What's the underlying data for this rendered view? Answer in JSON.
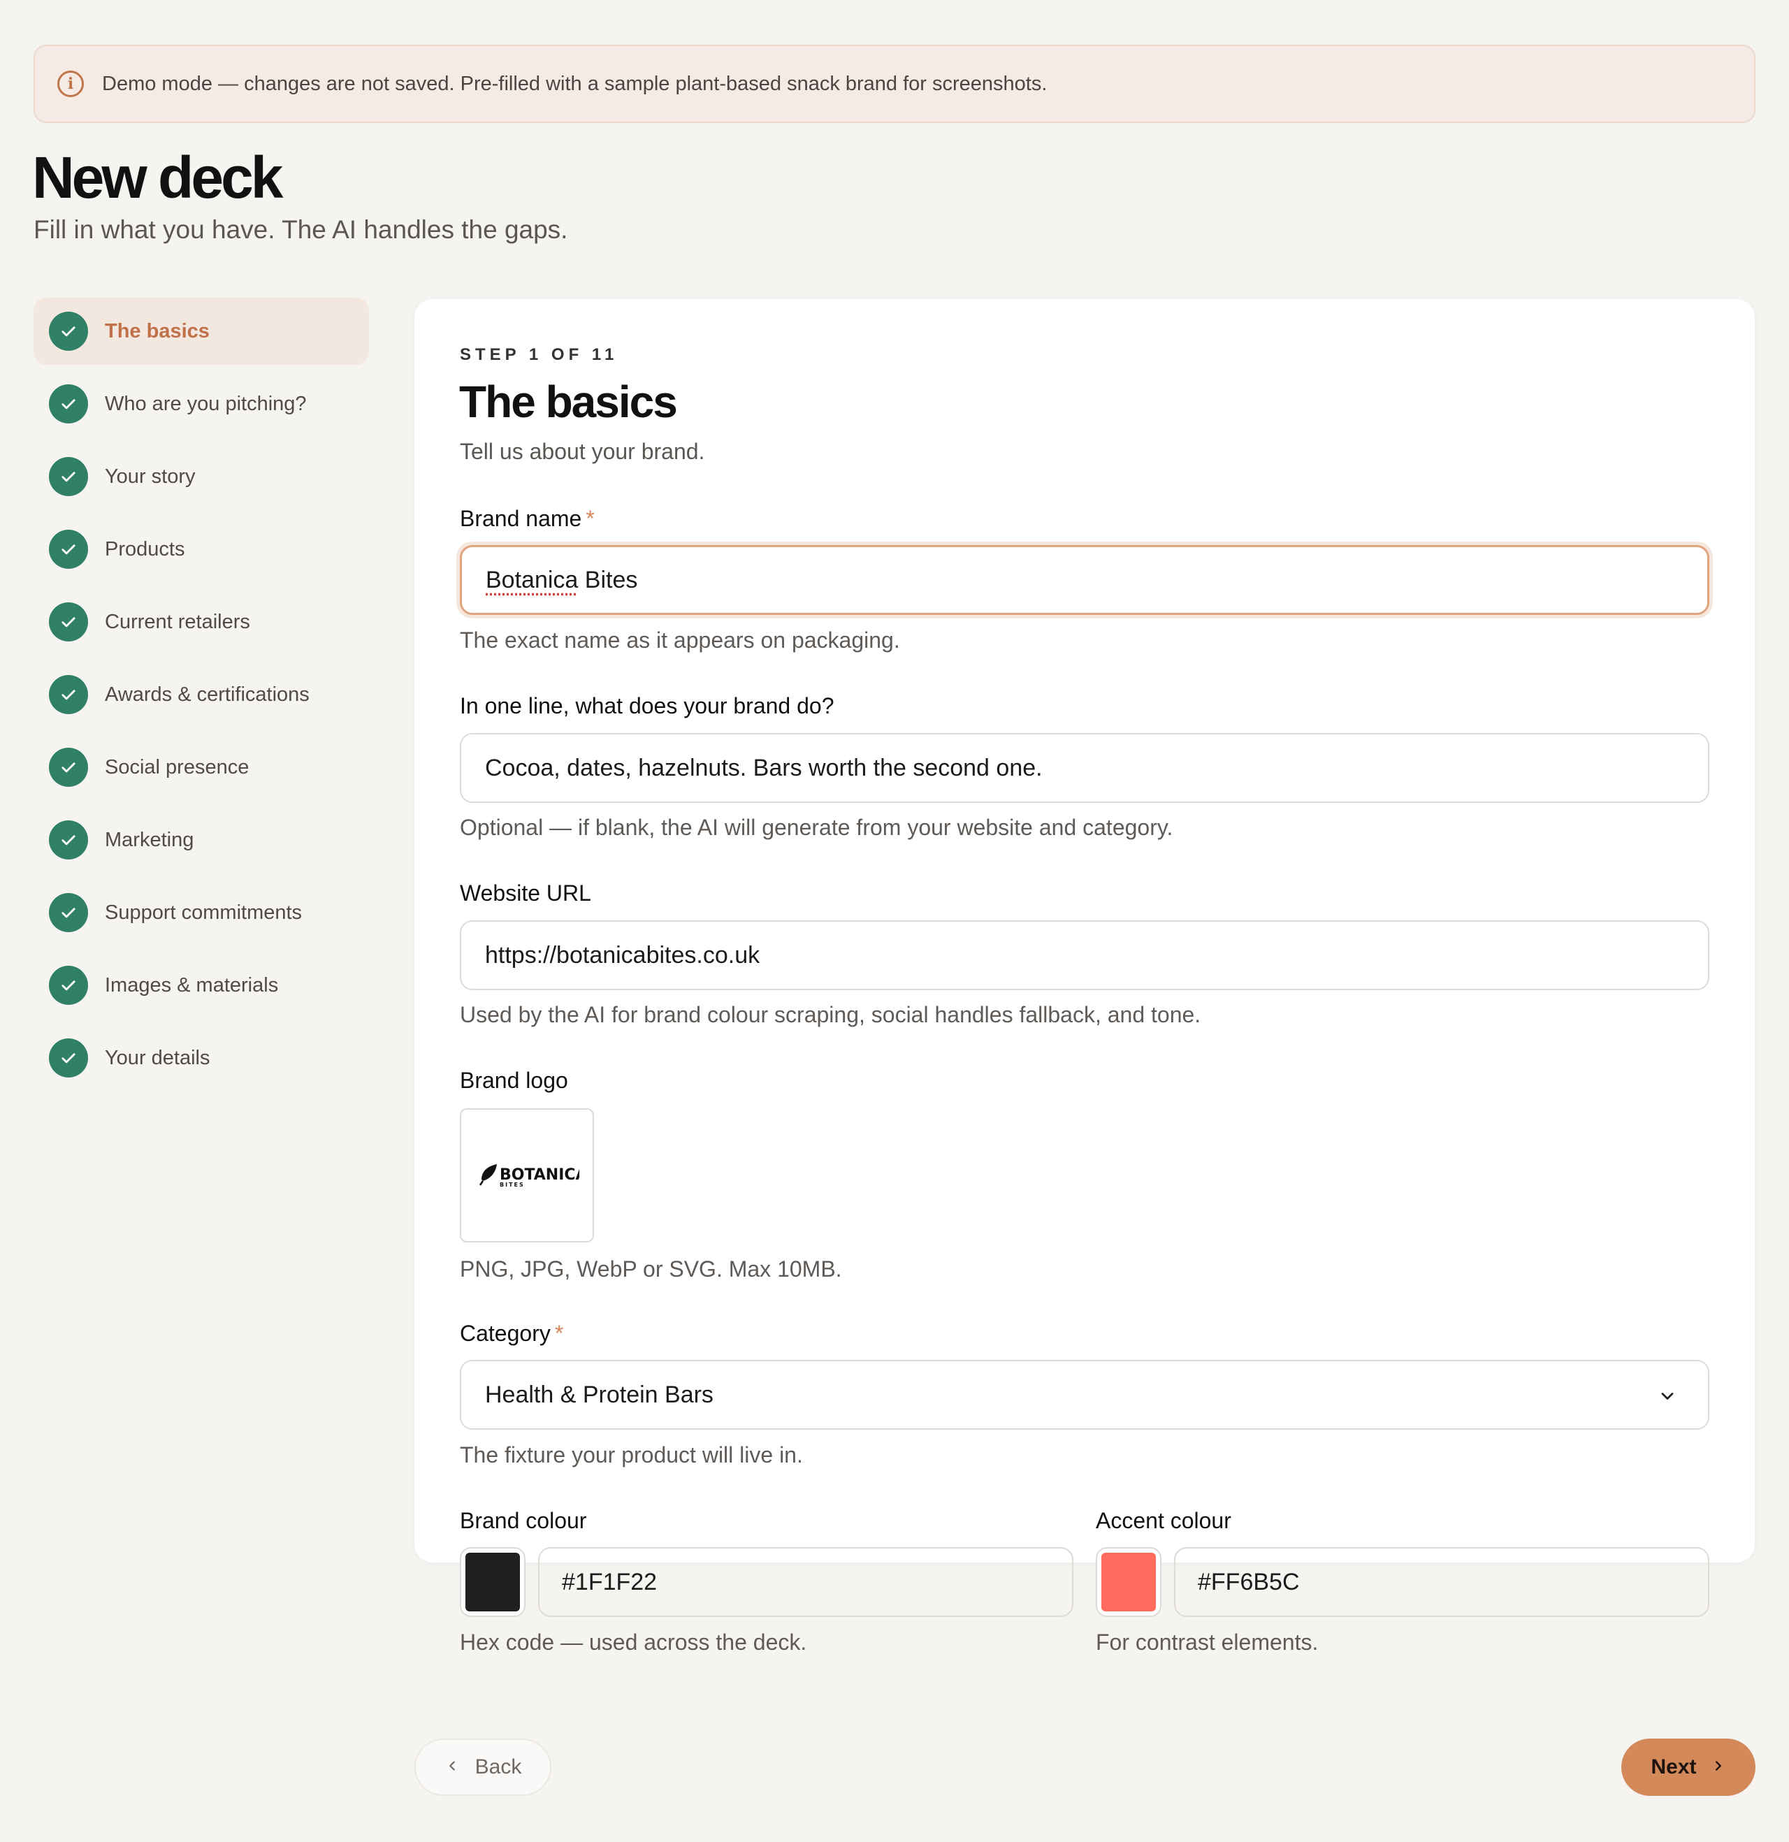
{
  "banner": {
    "icon": "info-icon",
    "text": "Demo mode — changes are not saved. Pre-filled with a sample plant-based snack brand for screenshots."
  },
  "page": {
    "title": "New deck",
    "subtitle": "Fill in what you have. The AI handles the gaps."
  },
  "sidebar": {
    "check_icon": "check-icon",
    "items": [
      {
        "label": "The basics",
        "active": true
      },
      {
        "label": "Who are you pitching?"
      },
      {
        "label": "Your story"
      },
      {
        "label": "Products"
      },
      {
        "label": "Current retailers"
      },
      {
        "label": "Awards & certifications"
      },
      {
        "label": "Social presence"
      },
      {
        "label": "Marketing"
      },
      {
        "label": "Support commitments"
      },
      {
        "label": "Images & materials"
      },
      {
        "label": "Your details"
      }
    ]
  },
  "step": {
    "kicker": "STEP 1 OF 11",
    "title": "The basics",
    "subtitle": "Tell us about your brand."
  },
  "fields": {
    "brand_name": {
      "label": "Brand name",
      "required_mark": "*",
      "value_part1": "Botanica",
      "value_part2": " Bites",
      "hint": "The exact name as it appears on packaging."
    },
    "one_line": {
      "label": "In one line, what does your brand do?",
      "value": "Cocoa, dates, hazelnuts. Bars worth the second one.",
      "hint": "Optional — if blank, the AI will generate from your website and category."
    },
    "website": {
      "label": "Website URL",
      "value": "https://botanicabites.co.uk",
      "hint": "Used by the AI for brand colour scraping, social handles fallback, and tone."
    },
    "logo": {
      "label": "Brand logo",
      "logo_word": "BOTANICA",
      "logo_sub": "BITES",
      "hint": "PNG, JPG, WebP or SVG. Max 10MB."
    },
    "category": {
      "label": "Category",
      "required_mark": "*",
      "value": "Health & Protein Bars",
      "hint": "The fixture your product will live in."
    },
    "brand_colour": {
      "label": "Brand colour",
      "value": "#1F1F22",
      "hint": "Hex code — used across the deck."
    },
    "accent_colour": {
      "label": "Accent colour",
      "value": "#FF6B5C",
      "hint": "For contrast elements."
    }
  },
  "nav": {
    "back_label": "Back",
    "next_label": "Next"
  },
  "colors": {
    "accent": "#d3895a",
    "check_green": "#2f8066",
    "brand_swatch": "#1F1F22",
    "accent_swatch": "#FF6B5C"
  }
}
